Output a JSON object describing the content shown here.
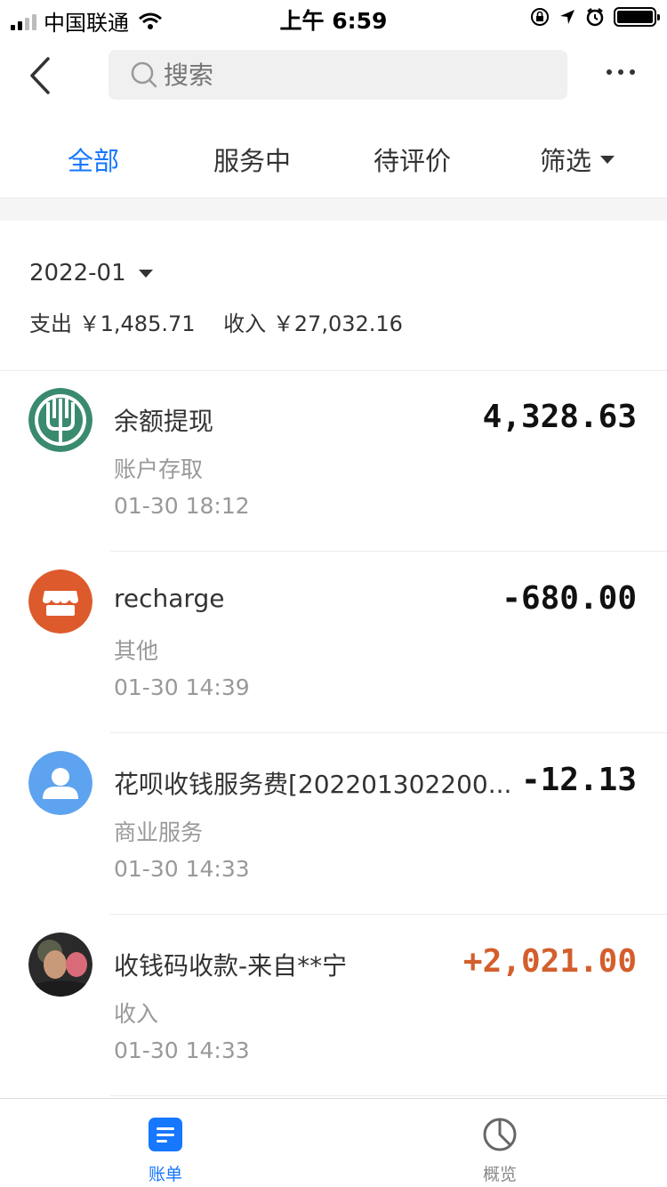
{
  "status_bar": {
    "carrier": "中国联通",
    "time": "上午 6:59"
  },
  "navbar": {
    "search_placeholder": "搜索"
  },
  "tabs": [
    {
      "label": "全部",
      "active": true
    },
    {
      "label": "服务中",
      "active": false
    },
    {
      "label": "待评价",
      "active": false
    },
    {
      "label": "筛选",
      "active": false
    }
  ],
  "summary": {
    "month": "2022-01",
    "expense": "支出 ￥1,485.71",
    "income": "收入 ￥27,032.16"
  },
  "transactions": [
    {
      "title": "余额提现",
      "category": "账户存取",
      "time": "01-30  18:12",
      "amount": "4,328.63",
      "icon": "bank-logo-icon"
    },
    {
      "title": "recharge",
      "category": "其他",
      "time": "01-30  14:39",
      "amount": "-680.00",
      "icon": "store-icon"
    },
    {
      "title": "花呗收钱服务费[202201302200...",
      "category": "商业服务",
      "time": "01-30  14:33",
      "amount": "-12.13",
      "icon": "user-icon"
    },
    {
      "title": "收钱码收款-来自**宁",
      "category": "收入",
      "time": "01-30  14:33",
      "amount": "+2,021.00",
      "icon": "photo-avatar"
    }
  ],
  "tabbar": {
    "bills": "账单",
    "overview": "概览"
  },
  "colors": {
    "accent": "#1677ff",
    "income_amount": "#d35f2c",
    "bank_green": "#3a8a6e",
    "store_orange": "#dd5a2c",
    "user_blue": "#5ea3ef"
  }
}
